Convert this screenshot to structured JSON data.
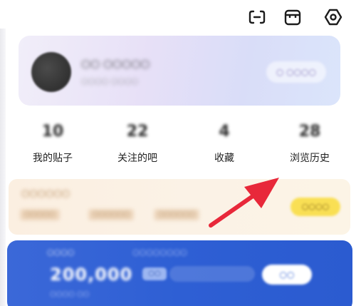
{
  "topbar": {
    "icons": [
      "scan-icon",
      "box-icon",
      "settings-icon"
    ]
  },
  "profile": {
    "name_blurred": "○○ ○○○○○",
    "sub_blurred": "○○○○ ○○○○",
    "vip_button_blurred": "○ ○○○○"
  },
  "stats": [
    {
      "value": "10",
      "label": "我的贴子"
    },
    {
      "value": "22",
      "label": "关注的吧"
    },
    {
      "value": "4",
      "label": "收藏"
    },
    {
      "value": "28",
      "label": "浏览历史"
    }
  ],
  "member": {
    "title_blurred": "○○○○○○",
    "tags_blurred": [
      "○○○○○",
      "○○○○○○",
      "○○○○○○"
    ],
    "button_blurred": "○○○○"
  },
  "points": {
    "title_blurred": "○○○○",
    "sub_blurred": "○○○○○○○○",
    "amount": "200,000",
    "badge_blurred": "○○",
    "foot_blurred": "○○○○ ○○",
    "button_blurred": "○○"
  },
  "colors": {
    "arrow": "#e8283a",
    "points_card": "#2e5fd4",
    "member_button": "#f9df54"
  }
}
